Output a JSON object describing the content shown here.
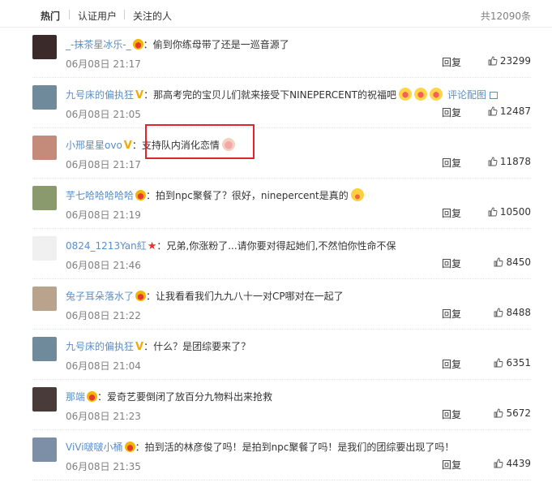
{
  "tabs": {
    "hot": "热门",
    "verified": "认证用户",
    "following": "关注的人"
  },
  "total": "共12090条",
  "reply_label": "回复",
  "comments": [
    {
      "user": "_-抹茶星冰乐-_",
      "badge": "crown",
      "text": "偷到你练母带了还是一巡音源了",
      "time": "06月08日 21:17",
      "likes": "23299",
      "avatar_color": "#3b2a2a"
    },
    {
      "user": "九号床的偏执狂",
      "badge": "v",
      "text": "那高考完的宝贝儿们就来接受下NINEPERCENT的祝福吧",
      "emojis": [
        "love",
        "love",
        "love"
      ],
      "extra_link": "评论配图",
      "time": "06月08日 21:05",
      "likes": "12487",
      "avatar_color": "#6f8a9a"
    },
    {
      "user": "小邢星星ovo",
      "badge": "v",
      "text": "支持队内消化恋情",
      "emojis": [
        "pig"
      ],
      "time": "06月08日 21:17",
      "likes": "11878",
      "avatar_color": "#c58b7a"
    },
    {
      "user": "芋七哈哈哈哈哈",
      "badge": "crown",
      "text": "拍到npc聚餐了？很好，ninepercent是真的",
      "emojis": [
        "yum"
      ],
      "time": "06月08日 21:19",
      "likes": "10500",
      "avatar_color": "#8a9a6d"
    },
    {
      "user": "0824_1213Yan紅",
      "badge": "star",
      "text": "兄弟,你涨粉了...请你要对得起她们,不然怕你性命不保",
      "time": "06月08日 21:46",
      "likes": "8450",
      "avatar_color": "#f0f0f0"
    },
    {
      "user": "兔子耳朵落水了",
      "badge": "crown",
      "text": "让我看看我们九九八十一对CP哪对在一起了",
      "time": "06月08日 21:22",
      "likes": "8488",
      "avatar_color": "#b9a38c"
    },
    {
      "user": "九号床的偏执狂",
      "badge": "v",
      "text": "什么？是团综要来了？",
      "time": "06月08日 21:04",
      "likes": "6351",
      "avatar_color": "#6f8a9a"
    },
    {
      "user": "那端",
      "badge": "crown",
      "text": "爱奇艺要倒闭了放百分九物料出来抢救",
      "time": "06月08日 21:23",
      "likes": "5672",
      "avatar_color": "#4a3b3b"
    },
    {
      "user": "ViVi啵啵小桶",
      "badge": "crown",
      "text": "拍到活的林彦俊了吗！是拍到npc聚餐了吗！是我们的团综要出现了吗！",
      "time": "06月08日 21:35",
      "likes": "4439",
      "avatar_color": "#7d8fa6"
    }
  ],
  "colors": {
    "link": "#5c8ec6",
    "highlight": "#e0252b"
  }
}
